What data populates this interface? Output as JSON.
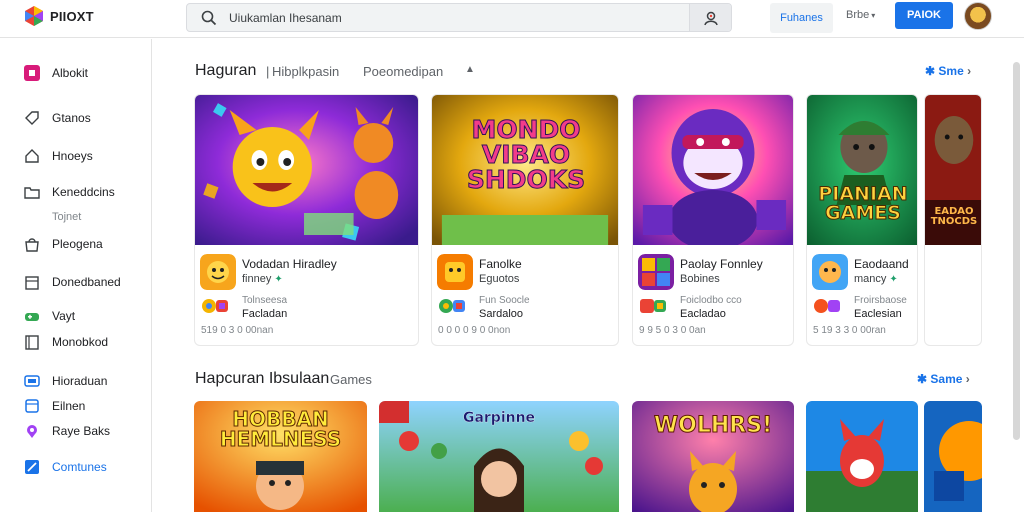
{
  "header": {
    "brand": "PIIOXT",
    "search_text": "Uiukamlan Ihesanam",
    "nav_tab": "Fuhanes",
    "nav_link": "Brbe",
    "cta_label": "PAIOK"
  },
  "sidebar": {
    "items": [
      {
        "label": "Albokit",
        "icon": "app-square-icon"
      },
      {
        "label": "Gtanos",
        "icon": "tag-icon"
      },
      {
        "label": "Hnoeys",
        "icon": "home-icon"
      },
      {
        "label": "Keneddcins",
        "icon": "folder-icon"
      },
      {
        "label": "Pleogena",
        "icon": "bag-icon"
      },
      {
        "label": "Donedbaned",
        "icon": "calendar-icon"
      },
      {
        "label": "Vayt",
        "icon": "gamepad-icon"
      },
      {
        "label": "Monobkod",
        "icon": "book-icon"
      },
      {
        "label": "Hioraduan",
        "icon": "tv-icon"
      },
      {
        "label": "Eilnen",
        "icon": "film-icon"
      },
      {
        "label": "Raye Baks",
        "icon": "pin-icon"
      },
      {
        "label": "Comtunes",
        "icon": "expand-icon"
      }
    ],
    "sub_label": "Tojnet"
  },
  "section1": {
    "title": "Haguran",
    "subtitle_a": "Hibplkpasin",
    "subtitle_b": "Poeomedipan",
    "more_label": "Sme",
    "cards": [
      {
        "art_text": "",
        "title": "Vodadan Hiradley",
        "subtitle": "finney",
        "meta": "Tolnseesa",
        "publisher": "Facladan",
        "stats": "519 0 3 0 00nan"
      },
      {
        "art_text": "MONDO VIBAO SHDOKS",
        "title": "Fanolke",
        "subtitle": "Eguotos",
        "meta": "Fun Soocle",
        "publisher": "Sardaloo",
        "stats": "0 0 0 0 9 0 0non"
      },
      {
        "art_text": "",
        "title": "Paolay Fonnley",
        "subtitle": "Bobines",
        "meta": "Foiclodbo cco",
        "publisher": "Eacladao",
        "stats": "9 9 5 0 3 0 0an"
      },
      {
        "art_text": "PIANIAN GAMES",
        "title": "Eaodaand",
        "subtitle": "mancy",
        "meta": "Froirsbaose",
        "publisher": "Eaclesian",
        "stats": "5 19 3 3 0 00ran"
      },
      {
        "art_text": "EADAO TNOCDS",
        "title": "",
        "subtitle": "",
        "meta": "",
        "publisher": "",
        "stats": ""
      }
    ]
  },
  "section2": {
    "title": "Hapcuran Ibsulaan",
    "subtitle": "Games",
    "more_label": "Same",
    "cards": [
      {
        "art_text": "HOBBAN HEMLNESS"
      },
      {
        "art_text": "Garpinne"
      },
      {
        "art_text": "WOLHRS!"
      },
      {
        "art_text": ""
      },
      {
        "art_text": ""
      }
    ]
  }
}
